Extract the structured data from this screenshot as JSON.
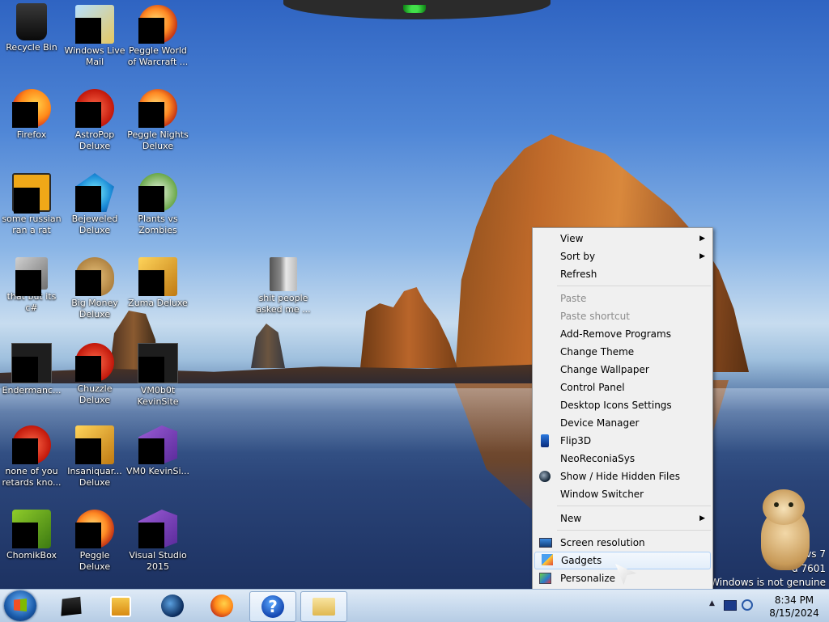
{
  "desktop_icons": [
    {
      "label": "Recycle Bin",
      "icon": "recycle-bin-icon"
    },
    {
      "label": "Windows Live Mail",
      "icon": "mail-icon"
    },
    {
      "label": "Peggle World of Warcraft ...",
      "icon": "peggle-icon"
    },
    {
      "label": "Firefox",
      "icon": "firefox-icon"
    },
    {
      "label": "AstroPop Deluxe",
      "icon": "astropop-icon"
    },
    {
      "label": "Peggle Nights Deluxe",
      "icon": "peggle-nights-icon"
    },
    {
      "label": "some russian ran a rat",
      "icon": "ie-icon"
    },
    {
      "label": "Bejeweled Deluxe",
      "icon": "gem-icon"
    },
    {
      "label": "Plants vs Zombies",
      "icon": "plant-icon"
    },
    {
      "label": "that but its c#",
      "icon": "shortcut-icon"
    },
    {
      "label": "Big Money Deluxe",
      "icon": "money-bag-icon"
    },
    {
      "label": "Zuma Deluxe",
      "icon": "zuma-icon"
    },
    {
      "label": "shit people asked me ...",
      "icon": "folder-icon"
    },
    {
      "label": "Endermanc...",
      "icon": "terminal-icon"
    },
    {
      "label": "Chuzzle Deluxe",
      "icon": "chuzzle-icon"
    },
    {
      "label": "VM0b0t KevinSite",
      "icon": "vm-icon"
    },
    {
      "label": "none of you retards kno...",
      "icon": "red-ball-icon"
    },
    {
      "label": "Insaniquar... Deluxe",
      "icon": "fish-icon"
    },
    {
      "label": "VM0 KevinSi...",
      "icon": "vs-icon"
    },
    {
      "label": "ChomikBox",
      "icon": "chomikbox-icon"
    },
    {
      "label": "Peggle Deluxe",
      "icon": "peggle-deluxe-icon"
    },
    {
      "label": "Visual Studio 2015",
      "icon": "visual-studio-icon"
    }
  ],
  "context_menu": {
    "items": [
      {
        "label": "View",
        "submenu": true
      },
      {
        "label": "Sort by",
        "submenu": true
      },
      {
        "label": "Refresh"
      },
      {
        "label": "Paste",
        "disabled": true
      },
      {
        "label": "Paste shortcut",
        "disabled": true
      },
      {
        "label": "Add-Remove Programs"
      },
      {
        "label": "Change Theme"
      },
      {
        "label": "Change Wallpaper"
      },
      {
        "label": "Control Panel"
      },
      {
        "label": "Desktop Icons Settings"
      },
      {
        "label": "Device Manager"
      },
      {
        "label": "Flip3D",
        "icon": "flip3d-icon"
      },
      {
        "label": "NeoReconiaSys"
      },
      {
        "label": "Show / Hide Hidden Files",
        "icon": "globe-icon"
      },
      {
        "label": "Window Switcher"
      },
      {
        "label": "New",
        "submenu": true
      },
      {
        "label": "Screen resolution",
        "icon": "screen-icon"
      },
      {
        "label": "Gadgets",
        "icon": "gadgets-icon",
        "highlighted": true
      },
      {
        "label": "Personalize",
        "icon": "personalize-icon"
      }
    ],
    "submenu_arrow": "▶"
  },
  "watermark": {
    "line1": "vs 7",
    "line2": "d 7601",
    "line3": "of Windows is not genuine"
  },
  "taskbar": {
    "help_glyph": "?",
    "tray_up_arrow": "▲",
    "clock_time": "8:34 PM",
    "clock_date": "8/15/2024"
  }
}
